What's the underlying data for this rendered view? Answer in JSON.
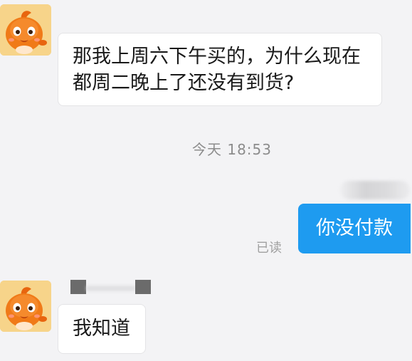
{
  "messages": [
    {
      "direction": "incoming",
      "avatar": "orange-mascot-icon",
      "text_lines": [
        "那我上周六下午买的，为什么现在",
        "都周二晚上了还没有到货?"
      ]
    },
    {
      "direction": "outgoing",
      "text": "你没付款",
      "status": "已读"
    },
    {
      "direction": "incoming",
      "avatar": "orange-mascot-icon",
      "text": "我知道"
    }
  ],
  "timestamp": "今天  18:53",
  "colors": {
    "background": "#f3f3f5",
    "incoming_bubble": "#ffffff",
    "outgoing_bubble": "#1e9bf0",
    "timestamp_text": "#8c8c8c",
    "avatar_background": "#f7d48a",
    "mascot_body": "#f07a18"
  }
}
